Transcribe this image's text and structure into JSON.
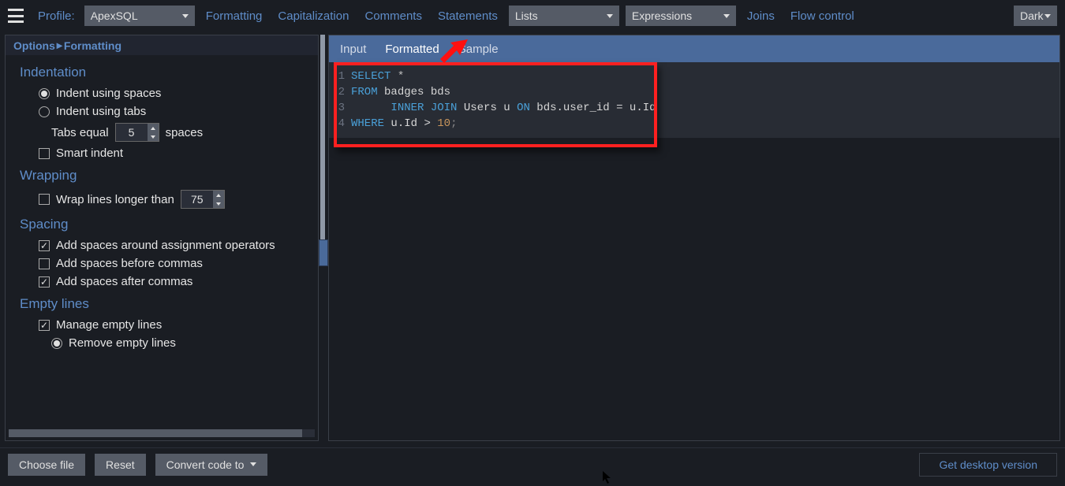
{
  "topbar": {
    "profile_label": "Profile:",
    "profile_value": "ApexSQL",
    "menu": {
      "formatting": "Formatting",
      "capitalization": "Capitalization",
      "comments": "Comments",
      "statements": "Statements",
      "lists": "Lists",
      "expressions": "Expressions",
      "joins": "Joins",
      "flow": "Flow control"
    },
    "theme": "Dark"
  },
  "options": {
    "breadcrumb_root": "Options",
    "breadcrumb_leaf": "Formatting",
    "indentation": {
      "title": "Indentation",
      "spaces_label": "Indent using spaces",
      "tabs_label": "Indent using tabs",
      "tabs_equal_pre": "Tabs equal",
      "tabs_equal_value": "5",
      "tabs_equal_post": "spaces",
      "smart_indent": "Smart indent"
    },
    "wrapping": {
      "title": "Wrapping",
      "wrap_label": "Wrap lines longer than",
      "wrap_value": "75"
    },
    "spacing": {
      "title": "Spacing",
      "assign": "Add spaces around assignment operators",
      "before_commas": "Add spaces before commas",
      "after_commas": "Add spaces after commas"
    },
    "empty": {
      "title": "Empty lines",
      "manage": "Manage empty lines",
      "remove": "Remove empty lines"
    }
  },
  "tabs": {
    "input": "Input",
    "formatted": "Formatted",
    "sample": "Sample"
  },
  "code": {
    "l1": {
      "n": "1",
      "select": "SELECT",
      "star": " *"
    },
    "l2": {
      "n": "2",
      "from": "FROM",
      "tbl": " badges bds"
    },
    "l3": {
      "n": "3",
      "pad": "      ",
      "inner": "INNER",
      "join": " JOIN",
      "users": " Users u ",
      "on": "ON",
      "cond": " bds.user_id ",
      "eq": "=",
      "rhs": " u.Id"
    },
    "l4": {
      "n": "4",
      "where": "WHERE",
      "lhs": " u.Id ",
      "gt": ">",
      "num": " 10",
      "semi": ";"
    }
  },
  "bottom": {
    "choose": "Choose file",
    "reset": "Reset",
    "convert": "Convert code to",
    "desktop": "Get desktop version"
  }
}
